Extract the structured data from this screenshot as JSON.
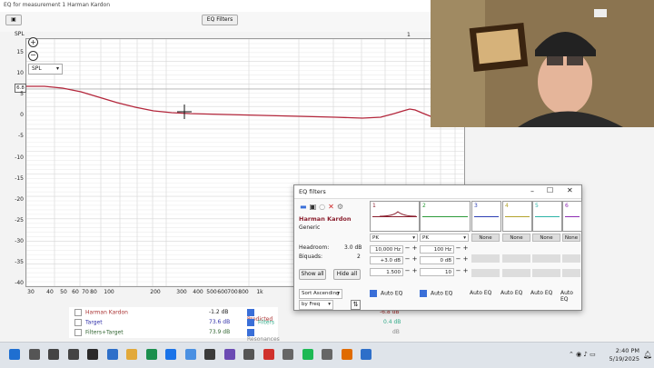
{
  "window": {
    "title": "EQ for measurement 1 Harman Kardon"
  },
  "toolbar": {
    "eq_filters_button": "EQ Filters",
    "one_label": "1"
  },
  "plot": {
    "y_axis_title": "SPL",
    "y_ticks": [
      "15",
      "10",
      "5",
      "0",
      "-5",
      "-10",
      "-15",
      "-20",
      "-25",
      "-30",
      "-35",
      "-40"
    ],
    "x_ticks": [
      "30",
      "40",
      "50",
      "60",
      "70",
      "80",
      "100",
      "200",
      "300",
      "400",
      "500",
      "600",
      "700",
      "800",
      "1k"
    ],
    "value_marker": "6.8",
    "spl_dropdown": "SPL",
    "curve_color": "#b3263b"
  },
  "legend": {
    "rows": [
      {
        "name": "Harman Kardon",
        "value": "-1.2 dB",
        "checked": false,
        "color": "#a33"
      },
      {
        "name": "Target",
        "value": "73.6 dB",
        "checked": false,
        "color": "#33a"
      },
      {
        "name": "Filters+Target",
        "value": "73.9 dB",
        "checked": false,
        "color": "#363"
      }
    ],
    "right_rows": [
      {
        "name": "Predicted",
        "value": "-6.8 dB",
        "checked": true
      },
      {
        "name": "Filters",
        "value": "0.4 dB",
        "checked": true
      },
      {
        "name": "Resonances",
        "value": "dB",
        "checked": true
      }
    ]
  },
  "eq_window": {
    "title": "EQ filters",
    "measurement_name": "Harman Kardon",
    "equaliser": "Generic",
    "headroom_label": "Headroom:",
    "headroom_value": "3.0 dB",
    "biquads_label": "Biquads:",
    "biquads_value": "2",
    "show_all": "Show all",
    "hide_all": "Hide all",
    "sort": "Sort Ascending",
    "sort_by": "by Freq",
    "slots": [
      {
        "n": "1",
        "type": "PK",
        "freq": "10,000 Hz",
        "gain": "+3.0 dB",
        "q": "1.500",
        "auto": "Auto EQ",
        "color": "#8a1f2e"
      },
      {
        "n": "2",
        "type": "PK",
        "freq": "100 Hz",
        "gain": "0 dB",
        "q": "10",
        "auto": "Auto EQ",
        "color": "#2d9b3a"
      },
      {
        "n": "3",
        "type": "None",
        "auto": "Auto EQ",
        "color": "#2d3fb3"
      },
      {
        "n": "4",
        "type": "None",
        "auto": "Auto EQ",
        "color": "#b3a42d"
      },
      {
        "n": "5",
        "type": "None",
        "auto": "Auto EQ",
        "color": "#2db3a7"
      },
      {
        "n": "6",
        "type": "None",
        "auto": "Auto EQ",
        "color": "#8e2db3"
      }
    ]
  },
  "taskbar": {
    "time": "2:40 PM",
    "date": "5/19/2025"
  }
}
